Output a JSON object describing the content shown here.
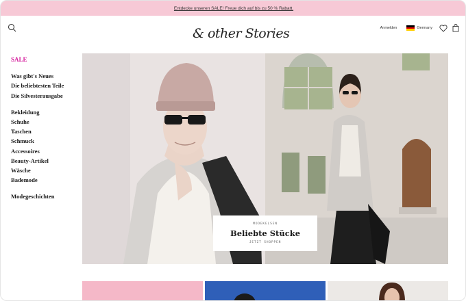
{
  "promo": {
    "text": "Entdecke unseren SALE! Freue dich auf bis zu 50 % Rabatt."
  },
  "header": {
    "logo": "& other Stories",
    "login_label": "Anmelden",
    "country_label": "Germany"
  },
  "sidebar": {
    "sale_label": "SALE",
    "group1": [
      "Was gibt's Neues",
      "Die beliebtesten Teile",
      "Die Silvesterausgabe"
    ],
    "group2": [
      "Bekleidung",
      "Schuhe",
      "Taschen",
      "Schmuck",
      "Accessoires",
      "Beauty-Artikel",
      "Wäsche",
      "Bademode"
    ],
    "group3": [
      "Modegeschichten"
    ]
  },
  "hero": {
    "eyebrow": "MODEKELSEN",
    "title": "Beliebte Stücke",
    "link": "JETZT SHOPPEN"
  },
  "colors": {
    "promo_bg": "#f7c9d6",
    "sale_accent": "#d6249f",
    "tile_pink": "#f5b8c8",
    "tile_blue": "#2f5fb8"
  },
  "icons": [
    "search-icon",
    "heart-icon",
    "bag-icon",
    "flag-de-icon"
  ]
}
